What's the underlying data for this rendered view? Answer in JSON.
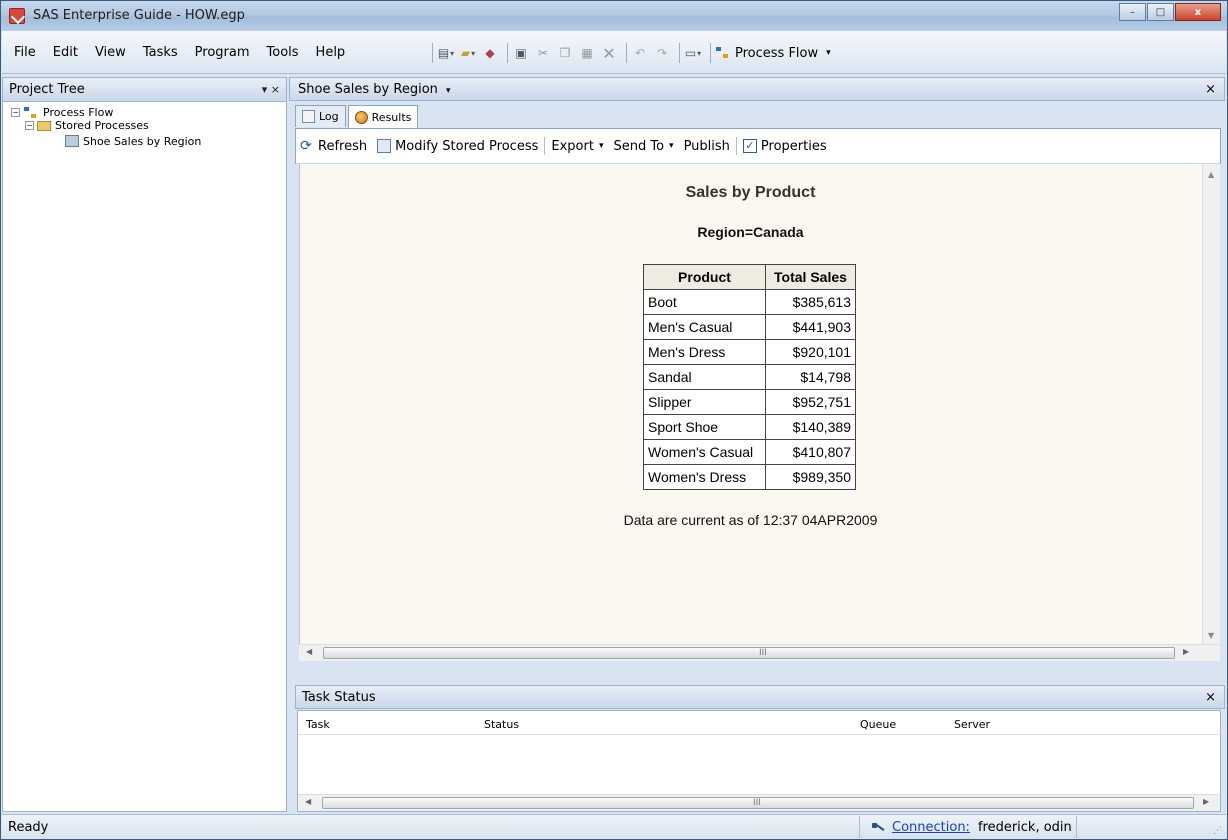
{
  "window": {
    "title": "SAS Enterprise Guide - HOW.egp",
    "minimize": "–",
    "maximize": "□",
    "close": "x"
  },
  "menu": [
    "File",
    "Edit",
    "View",
    "Tasks",
    "Program",
    "Tools",
    "Help"
  ],
  "toolbar": {
    "process_flow_label": "Process Flow"
  },
  "project_tree": {
    "title": "Project Tree",
    "controls": "▾ ×",
    "nodes": [
      {
        "label": "Process Flow"
      },
      {
        "label": "Stored Processes"
      },
      {
        "label": "Shoe Sales by Region"
      }
    ]
  },
  "main": {
    "title": "Shoe Sales by Region",
    "close": "×",
    "tabs": [
      {
        "label": "Log"
      },
      {
        "label": "Results"
      }
    ],
    "results_toolbar": {
      "refresh": "Refresh",
      "modify": "Modify Stored Process",
      "export": "Export",
      "send_to": "Send To",
      "publish": "Publish",
      "properties": "Properties"
    },
    "report": {
      "title": "Sales by Product",
      "subtitle": "Region=Canada",
      "columns": [
        "Product",
        "Total Sales"
      ],
      "rows": [
        [
          "Boot",
          "$385,613"
        ],
        [
          "Men's Casual",
          "$441,903"
        ],
        [
          "Men's Dress",
          "$920,101"
        ],
        [
          "Sandal",
          "$14,798"
        ],
        [
          "Slipper",
          "$952,751"
        ],
        [
          "Sport Shoe",
          "$140,389"
        ],
        [
          "Women's Casual",
          "$410,807"
        ],
        [
          "Women's Dress",
          "$989,350"
        ]
      ],
      "footnote": "Data are current as of 12:37 04APR2009"
    }
  },
  "task_status": {
    "title": "Task Status",
    "close": "×",
    "columns": [
      "Task",
      "Status",
      "Queue",
      "Server"
    ]
  },
  "statusbar": {
    "left": "Ready",
    "connection_label": "Connection:",
    "connection_value": "frederick, odin"
  }
}
